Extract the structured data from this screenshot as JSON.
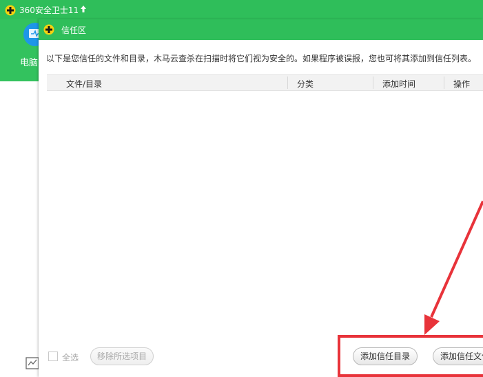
{
  "app": {
    "title": "360安全卫士11",
    "pc_label": "电脑"
  },
  "dialog": {
    "title": "信任区",
    "description": "以下是您信任的文件和目录，木马云查杀在扫描时将它们视为安全的。如果程序被误报，您也可将其添加到信任列表。",
    "columns": [
      "文件/目录",
      "分类",
      "添加时间",
      "操作"
    ]
  },
  "bottom": {
    "select_all_label": "全选",
    "remove_selected_label": "移除所选项目",
    "add_trusted_dir_label": "添加信任目录",
    "add_trusted_file_label": "添加信任文件"
  },
  "colors": {
    "brand_green": "#2fbe5a",
    "annotation_red": "#e8333a"
  }
}
